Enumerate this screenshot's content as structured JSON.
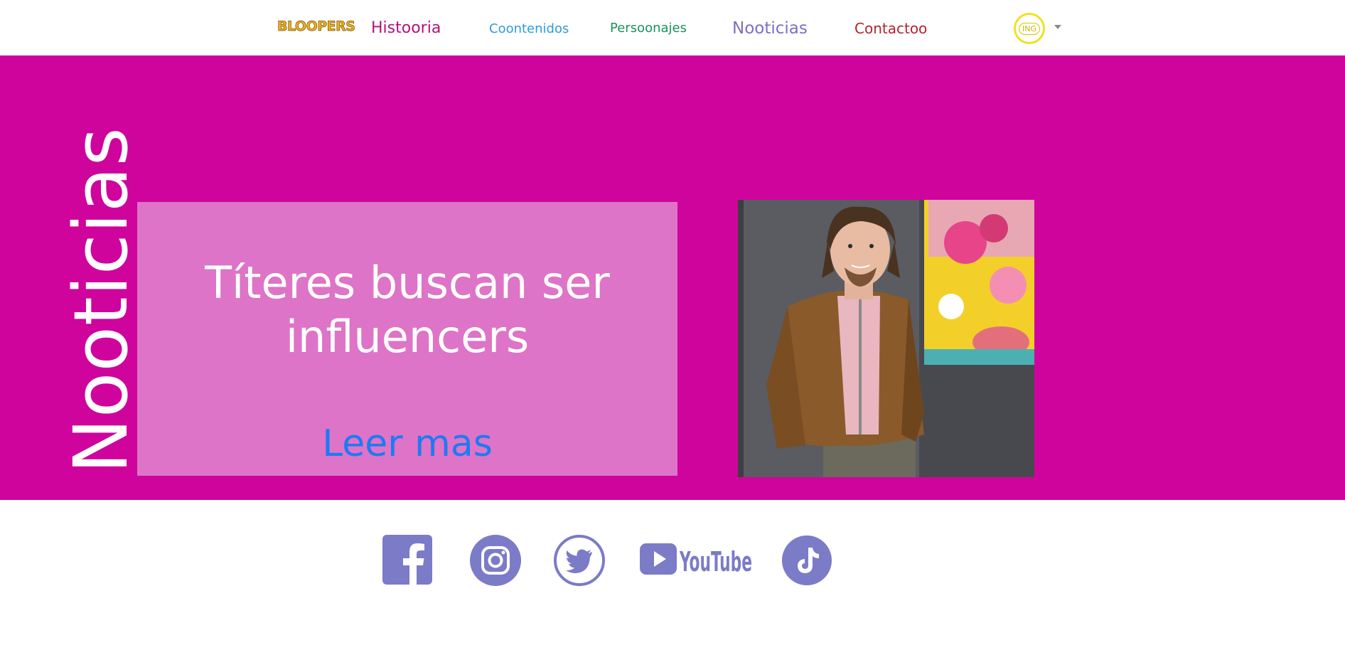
{
  "navbar": {
    "brand": "BLOOPERS",
    "links": [
      {
        "label": "Histooria",
        "color": "#b3127a"
      },
      {
        "label": "Coontenidos",
        "color": "#2f9bd6"
      },
      {
        "label": "Persoonajes",
        "color": "#19925a"
      },
      {
        "label": "Nooticias",
        "color": "#7b6fc6"
      },
      {
        "label": "Contactoo",
        "color": "#b5232f"
      }
    ],
    "language": {
      "label": "ING",
      "icon": "language-badge-icon"
    }
  },
  "hero": {
    "background": "#cf049d",
    "vertical_title": "Nooticias",
    "card": {
      "headline": "Títeres buscan ser influencers",
      "link_label": "Leer mas"
    },
    "photo": {
      "icon": "news-photo"
    }
  },
  "footer": {
    "social": [
      {
        "name": "Facebook",
        "icon": "facebook-icon"
      },
      {
        "name": "Instagram",
        "icon": "instagram-icon"
      },
      {
        "name": "Twitter",
        "icon": "twitter-icon"
      },
      {
        "name": "YouTube",
        "icon": "youtube-icon",
        "text": "YouTube"
      },
      {
        "name": "TikTok",
        "icon": "tiktok-icon"
      }
    ],
    "icon_color": "#7b7bc8"
  }
}
